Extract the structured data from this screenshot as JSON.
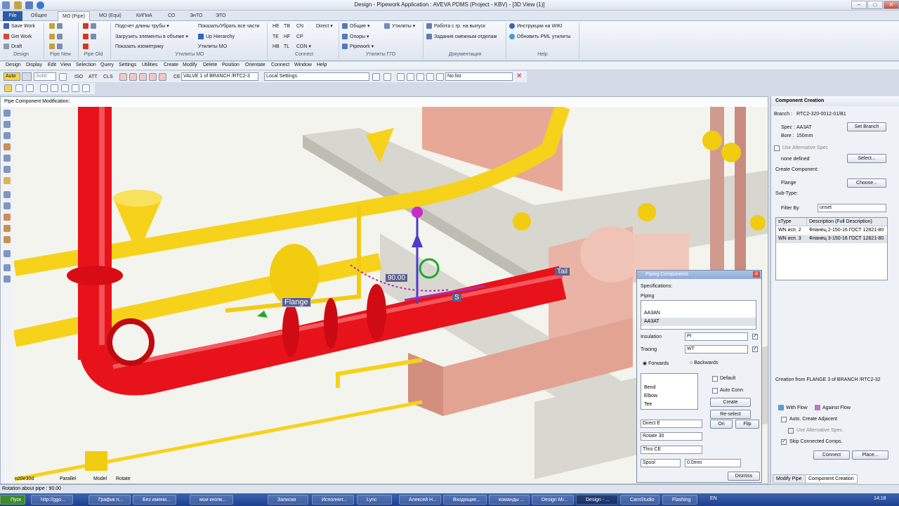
{
  "window": {
    "title": "Design - Pipework Application : AVEVA PDMS (Project - KBV) - [3D View (1)]"
  },
  "tabs": [
    {
      "label": "File"
    },
    {
      "label": "Общее"
    },
    {
      "label": "МО (Pipe)"
    },
    {
      "label": "МО (Equi)"
    },
    {
      "label": "КИПиА"
    },
    {
      "label": "СО"
    },
    {
      "label": "ЭнТО"
    },
    {
      "label": "ЭТО"
    }
  ],
  "ribbon": {
    "design": {
      "items": [
        "Save Work",
        "Get Work",
        "Draft"
      ],
      "group": "Design"
    },
    "pipe_new": {
      "group": "Pipe New"
    },
    "pipe_old": {
      "group": "Pipe Old"
    },
    "mo": {
      "items": [
        "Подсчет длины трубы",
        "Загрузить элементы в объеме",
        "Показать изометрику",
        "Показать/Убрать все части",
        "Up Hierarchy",
        "Утилиты МО"
      ],
      "group": "Утилиты МО"
    },
    "connect": {
      "items": [
        "HE",
        "TB",
        "CN",
        "TE",
        "HF",
        "CP",
        "HB",
        "TL",
        "CON",
        "Direct"
      ],
      "group": "Connect"
    },
    "ggo": {
      "items": [
        "Общие",
        "Опоры",
        "Pipework",
        "Утилиты"
      ],
      "group": "Утилиты ГГО"
    },
    "docs": {
      "items": [
        "Работа с гр. на выпуск",
        "Задания смежным отделам"
      ],
      "group": "Документация"
    },
    "help": {
      "items": [
        "Инструкции на WIKI",
        "Обновить PML утилиты"
      ],
      "group": "Help"
    }
  },
  "menu": [
    "Design",
    "Display",
    "Edit",
    "View",
    "Selection",
    "Query",
    "Settings",
    "Utilities",
    "Create",
    "Modify",
    "Delete",
    "Position",
    "Orientate",
    "Connect",
    "Window",
    "Help"
  ],
  "toolbar": {
    "auto": "Auto",
    "solid": "Solid",
    "iso": "ISO",
    "att": "ATT",
    "cls": "CLS",
    "ce": "CE",
    "ce_value": "VALVE 1 of BRANCH /RTC2-3",
    "local_settings": "Local Settings",
    "no_list": "No list"
  },
  "viewport": {
    "header": "Pipe Component Modification:",
    "labels": {
      "flange": "Flange",
      "tail": "Tail",
      "angle": "90.00",
      "s": "S"
    },
    "footer": {
      "coord": "n20e30d",
      "parallel": "Parallel",
      "model": "Model",
      "rotate": "Rotate"
    }
  },
  "component_creation": {
    "title": "Component Creation",
    "branch_label": "Branch :",
    "branch": "RTC2-320-0012-01/B1",
    "spec_label": "Spec :",
    "spec": "AA3AT",
    "bore_label": "Bore :",
    "bore": "150mm",
    "set_branch": "Set Branch",
    "use_alt_spec": "Use Alternative Spec",
    "none_defined": "none defined",
    "select": "Select...",
    "create_component": "Create Component:",
    "component": "Flange",
    "choose": "Choose...",
    "subtype": "Sub-Type:",
    "filter_by": "Filter By",
    "filter_value": "unset",
    "table_headers": [
      "sType",
      "Description (Full Description)"
    ],
    "rows": [
      [
        "WN исп. 2",
        "Фланец 2-150-16 ГОСТ 12821-80"
      ],
      [
        "WN исп. 3",
        "Фланец 3-150-16 ГОСТ 12821-80"
      ]
    ],
    "creation_from": "Creation from FLANGE 3 of BRANCH /RTC2-32",
    "with_flow": "With Flow",
    "against_flow": "Against Flow",
    "auto_adjacent": "Auto. Create Adjacent",
    "use_alt_spec2": "Use Alternative Spec.",
    "skip_connected": "Skip Connected Comps.",
    "connect": "Connect",
    "place": "Place...",
    "tab_modify": "Modify Pipe",
    "tab_creation": "Component Creation"
  },
  "piping_dialog": {
    "title": "Piping Components",
    "specifications": "Specifications:",
    "piping": "Piping",
    "piping_list": [
      "AA3AN",
      "AA3AT"
    ],
    "insulation_label": "Insulation",
    "insulation": "PI",
    "tracing_label": "Tracing",
    "tracing": "WT",
    "forwards": "Forwards",
    "backwards": "Backwards",
    "components": [
      "Bend",
      "Elbow",
      "Tee"
    ],
    "default": "Default",
    "auto_conn": "Auto Conn",
    "create": "Create",
    "reselect": "Re-select",
    "ori": "Ori",
    "flip": "Flip",
    "direct": "Direct E",
    "rotate": "Rotate 30",
    "thro": "Thro CE",
    "spool": "Spool",
    "spool_value": "0.0mm",
    "dismiss": "Dismiss"
  },
  "status": "Rotation about pipe : 90.00",
  "taskbar": {
    "start": "Пуск",
    "items": [
      "http://ggo...",
      "График п...",
      "Без имени...",
      "мои кнопк...",
      "Записки",
      "Исполнит...",
      "Lync",
      "Алексей Н...",
      "Входящие...",
      "команды ...",
      "Design Mi...",
      "Design - ...",
      "CamStudio",
      "Flashing"
    ],
    "lang": "EN",
    "time": "14:18"
  },
  "colors": {
    "pipe_red": "#e8121b",
    "pipe_yellow": "#f6d21a",
    "equipment_salmon": "#e8a898",
    "ribbon_blue": "#2a5aa8"
  }
}
